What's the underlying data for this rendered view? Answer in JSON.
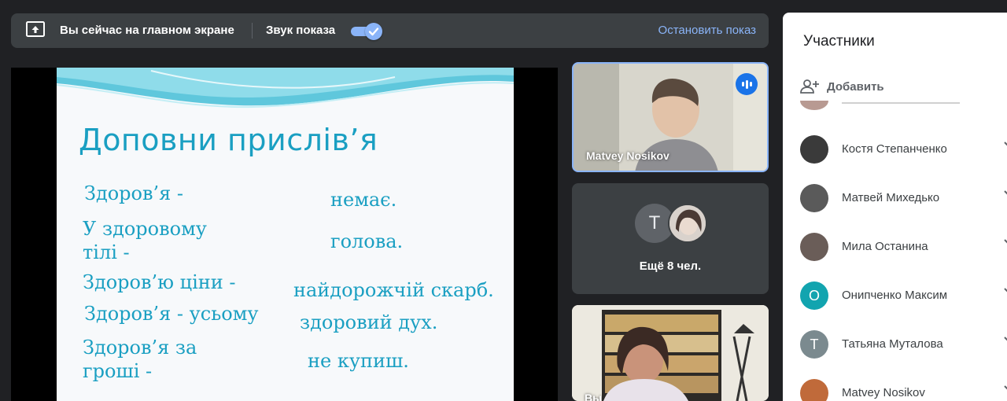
{
  "present_bar": {
    "status": "Вы сейчас на главном экране",
    "sound_label": "Звук показа",
    "sound_on": true,
    "stop_label": "Остановить показ"
  },
  "slide": {
    "title": "Доповни прислів’я",
    "left_lines": [
      "Здоров’я -",
      "У здоровому\nтілі -",
      "Здоров’ю ціни -",
      "Здоров’я - усьому",
      "Здоров’я за\nгроші -"
    ],
    "right_lines": [
      "немає.",
      "голова.",
      "найдорожчій скарб.",
      "здоровий дух.",
      "не купиш."
    ]
  },
  "tiles": {
    "main_name": "Matvey Nosikov",
    "more_initial": "Т",
    "more_label": "Ещё 8 чел.",
    "self_name": "Вы"
  },
  "participants": {
    "title": "Участники",
    "add_label": "Добавить",
    "items": [
      {
        "name": "Костя Степанченко",
        "initial": "",
        "color": "#3a3a3a"
      },
      {
        "name": "Матвей Михедько",
        "initial": "",
        "color": "#5a5a5a"
      },
      {
        "name": "Мила Останина",
        "initial": "",
        "color": "#6a5d58"
      },
      {
        "name": "Онипченко Максим",
        "initial": "О",
        "color": "#12a4af"
      },
      {
        "name": "Татьяна Муталова",
        "initial": "Т",
        "color": "#7b8a8f"
      },
      {
        "name": "Matvey Nosikov",
        "initial": "",
        "color": "#c06a3a"
      }
    ]
  },
  "colors": {
    "accent": "#8ab4f8",
    "slide_text": "#1a9fc2",
    "bar_bg": "#3c4043",
    "page_bg": "#202124"
  },
  "icons": [
    "present-screen-icon",
    "check-icon",
    "speaking-indicator-icon",
    "add-person-icon",
    "chevron-icon"
  ]
}
